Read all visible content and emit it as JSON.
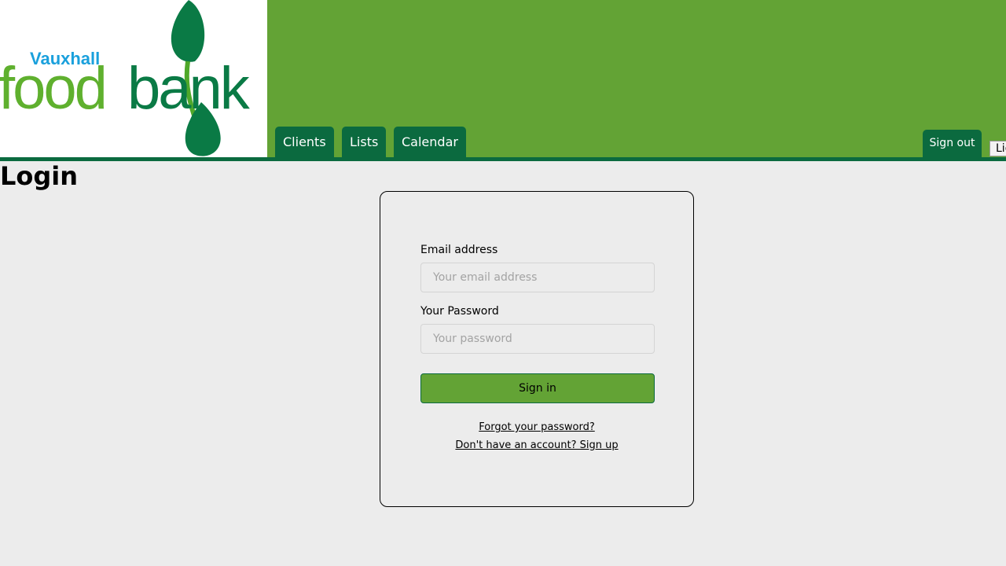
{
  "brand": {
    "logo_small": "Vauxhall",
    "logo_big_left": "food",
    "logo_big_right": "bank"
  },
  "nav": {
    "items": [
      "Clients",
      "Lists",
      "Calendar"
    ]
  },
  "header": {
    "sign_out": "Sign out",
    "light_button": "Light"
  },
  "page": {
    "title": "Login"
  },
  "login": {
    "email_label": "Email address",
    "email_placeholder": "Your email address",
    "email_value": "",
    "password_label": "Your Password",
    "password_placeholder": "Your password",
    "password_value": "",
    "submit": "Sign in",
    "forgot_link": "Forgot your password?",
    "signup_link": "Don't have an account? Sign up"
  },
  "colors": {
    "header_green": "#63a335",
    "dark_green": "#0b6a3f",
    "logo_blue": "#1aa0dc",
    "background": "#ececec"
  }
}
